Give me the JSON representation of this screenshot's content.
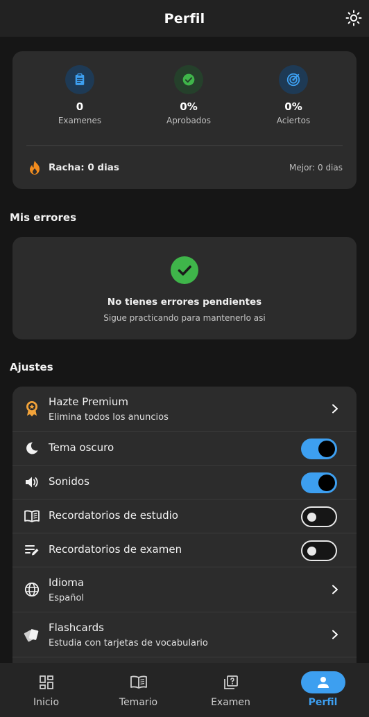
{
  "header": {
    "title": "Perfil"
  },
  "stats": {
    "exams": {
      "value": "0",
      "label": "Examenes"
    },
    "passed": {
      "value": "0%",
      "label": "Aprobados"
    },
    "correct": {
      "value": "0%",
      "label": "Aciertos"
    },
    "streak_label": "Racha: 0 dias",
    "best_label": "Mejor: 0 dias"
  },
  "errors": {
    "section_title": "Mis errores",
    "title": "No tienes errores pendientes",
    "subtitle": "Sigue practicando para mantenerlo asi"
  },
  "settings": {
    "section_title": "Ajustes",
    "premium": {
      "label": "Hazte Premium",
      "sub": "Elimina todos los anuncios"
    },
    "dark_theme": {
      "label": "Tema oscuro",
      "on": true
    },
    "sounds": {
      "label": "Sonidos",
      "on": true
    },
    "study_reminders": {
      "label": "Recordatorios de estudio",
      "on": false
    },
    "exam_reminders": {
      "label": "Recordatorios de examen",
      "on": false
    },
    "language": {
      "label": "Idioma",
      "sub": "Español"
    },
    "flashcards": {
      "label": "Flashcards",
      "sub": "Estudia con tarjetas de vocabulario"
    }
  },
  "nav": {
    "items": [
      {
        "label": "Inicio"
      },
      {
        "label": "Temario"
      },
      {
        "label": "Examen"
      },
      {
        "label": "Perfil"
      }
    ],
    "active_index": 3
  },
  "colors": {
    "accent": "#3d9ff0",
    "success": "#3fb54a",
    "streak": "#f28c1e",
    "premium": "#f2a33a"
  }
}
